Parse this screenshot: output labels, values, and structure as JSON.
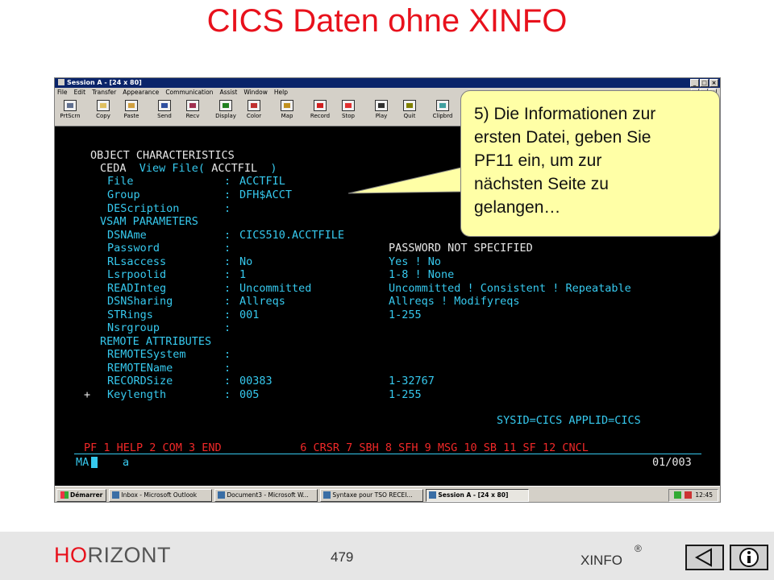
{
  "slide": {
    "title": "CICS Daten ohne XINFO",
    "callout_lines": [
      "5) Die Informationen zur",
      "ersten Datei, geben Sie",
      "PF11 ein, um zur",
      "nächsten Seite zu",
      "gelangen…"
    ]
  },
  "window": {
    "title": "Session A - [24 x 80]",
    "menu": [
      "File",
      "Edit",
      "Transfer",
      "Appearance",
      "Communication",
      "Assist",
      "Window",
      "Help"
    ],
    "toolbar": [
      {
        "label": "PrtScrn",
        "icon": "print-screen-icon"
      },
      {
        "label": "Copy",
        "icon": "copy-icon"
      },
      {
        "label": "Paste",
        "icon": "paste-icon"
      },
      {
        "label": "Send",
        "icon": "send-icon"
      },
      {
        "label": "Recv",
        "icon": "receive-icon"
      },
      {
        "label": "Display",
        "icon": "display-icon"
      },
      {
        "label": "Color",
        "icon": "color-icon"
      },
      {
        "label": "Map",
        "icon": "map-icon"
      },
      {
        "label": "Record",
        "icon": "record-icon"
      },
      {
        "label": "Stop",
        "icon": "stop-icon"
      },
      {
        "label": "Play",
        "icon": "play-icon"
      },
      {
        "label": "Quit",
        "icon": "quit-icon"
      },
      {
        "label": "Clipbrd",
        "icon": "clipboard-icon"
      }
    ]
  },
  "terminal": {
    "header": "OBJECT CHARACTERISTICS",
    "ceda_cmd": "CEDA",
    "ceda_view": "View File(",
    "ceda_name": "ACCTFIL",
    "ceda_close": ")",
    "rows": [
      {
        "label": "File",
        "value": "ACCTFIL",
        "range": ""
      },
      {
        "label": "Group",
        "value": "DFH$ACCT",
        "range": ""
      },
      {
        "label": "DEScription",
        "value": "",
        "range": ""
      },
      {
        "section": "VSAM PARAMETERS"
      },
      {
        "label": "DSNAme",
        "value": "CICS510.ACCTFILE",
        "range": ""
      },
      {
        "label": "Password",
        "value": "",
        "range": "PASSWORD NOT SPECIFIED"
      },
      {
        "label": "RLsaccess",
        "value": "No",
        "range": "Yes ! No"
      },
      {
        "label": "Lsrpoolid",
        "value": "1",
        "range": "1-8 ! None"
      },
      {
        "label": "READInteg",
        "value": "Uncommitted",
        "range": "Uncommitted ! Consistent ! Repeatable"
      },
      {
        "label": "DSNSharing",
        "value": "Allreqs",
        "range": "Allreqs ! Modifyreqs"
      },
      {
        "label": "STRings",
        "value": "001",
        "range": "1-255"
      },
      {
        "label": "Nsrgroup",
        "value": "",
        "range": ""
      },
      {
        "section": "REMOTE ATTRIBUTES"
      },
      {
        "label": "REMOTESystem",
        "value": "",
        "range": ""
      },
      {
        "label": "REMOTEName",
        "value": "",
        "range": ""
      },
      {
        "label": "RECORDSize",
        "value": "00383",
        "range": "1-32767"
      },
      {
        "label": "Keylength",
        "value": "005",
        "range": "1-255"
      }
    ],
    "plus_marker": "+",
    "sysid_line": "SYSID=CICS APPLID=CICS",
    "pf_line": "PF 1 HELP 2 COM 3 END            6 CRSR 7 SBH 8 SFH 9 MSG 10 SB 11 SF 12 CNCL",
    "cmd_prefix": "MA",
    "cmd_input": "a",
    "page_indicator": "01/003"
  },
  "taskbar": {
    "start": "Démarrer",
    "items": [
      "Inbox - Microsoft Outlook",
      "Document3 - Microsoft W...",
      "Syntaxe pour TSO RECEI...",
      "Session A - [24 x 80]"
    ],
    "clock": "12:45"
  },
  "footer": {
    "brand_ho": "HO",
    "brand_rest": "RIZONT",
    "page": "479",
    "product": "XINFO",
    "registered": "®"
  },
  "colors": {
    "title_red": "#e8111c",
    "term_white": "#e8e8e8",
    "term_turquoise": "#36c9ee",
    "term_yellow": "#ece85a",
    "term_red": "#f02828",
    "callout_fill": "#ffffa6"
  }
}
